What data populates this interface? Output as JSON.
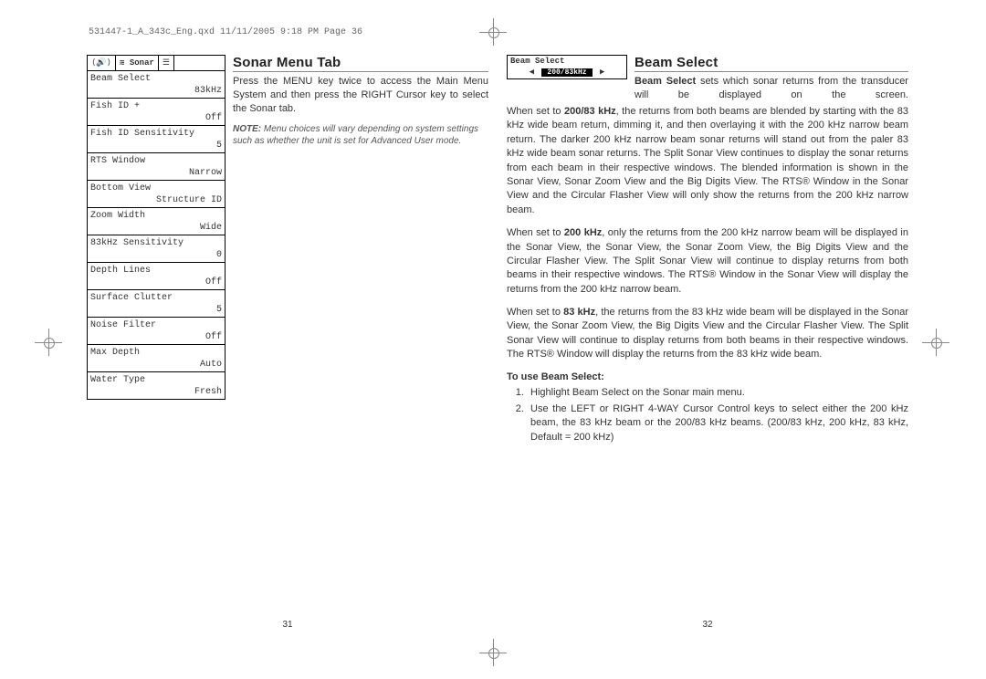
{
  "header_slug": "531447-1_A_343c_Eng.qxd  11/11/2005  9:18 PM  Page 36",
  "left": {
    "menu_caption": "Sonar Menu",
    "tabs": {
      "t1": "⟨🔊⟩",
      "t2": "≋ Sonar",
      "t3": "☰"
    },
    "rows": {
      "r0l": "Beam Select",
      "r0v": "83kHz",
      "r1l": "Fish ID +",
      "r1v": "Off",
      "r2l": "Fish ID Sensitivity",
      "r2v": "5",
      "r3l": "RTS Window",
      "r3v": "Narrow",
      "r4l": "Bottom View",
      "r4v": "Structure ID",
      "r5l": "Zoom Width",
      "r5v": "Wide",
      "r6l": "83kHz Sensitivity",
      "r6v": "0",
      "r7l": "Depth Lines",
      "r7v": "Off",
      "r8l": "Surface Clutter",
      "r8v": "5",
      "r9l": "Noise Filter",
      "r9v": "Off",
      "r10l": "Max Depth",
      "r10v": "Auto",
      "r11l": "Water Type",
      "r11v": "Fresh"
    },
    "heading": "Sonar Menu Tab",
    "body": "Press the MENU key twice to access the Main Menu System and then press the RIGHT Cursor key to select the Sonar tab.",
    "note_label": "NOTE:",
    "note": " Menu choices will vary depending on system settings such as whether the unit is set for Advanced User mode.",
    "page_num": "31"
  },
  "right": {
    "beam_title": "Beam Select",
    "beam_value": "200/83kHz",
    "heading": "Beam Select",
    "intro_b": "Beam Select",
    "intro": " sets which sonar returns from the transducer will be displayed on the screen.",
    "p1a": "When set to ",
    "p1b": "200/83 kHz",
    "p1c": ", the returns from both beams are blended by starting with the 83 kHz wide beam return, dimming it, and then overlaying it with the 200 kHz narrow beam return.  The darker 200 kHz narrow beam sonar returns will stand out from the paler 83 kHz wide beam sonar returns. The Split Sonar View continues to display the sonar returns from each beam in their respective windows.  The blended information is shown in the Sonar View, Sonar Zoom View and the Big Digits View. The RTS® Window in the Sonar View and the Circular Flasher View will only show the returns from the 200 kHz narrow beam.",
    "p2a": "When set to ",
    "p2b": "200 kHz",
    "p2c": ", only the returns from the 200 kHz narrow beam will be displayed in the Sonar View, the Sonar View, the Sonar Zoom View, the Big Digits View and the Circular Flasher View.  The Split Sonar View will continue to display returns from both beams in their respective windows.  The RTS® Window in the Sonar View will display the returns from the 200 kHz narrow beam.",
    "p3a": "When set to ",
    "p3b": "83 kHz",
    "p3c": ", the returns from the 83 kHz wide beam will be displayed in the Sonar View, the Sonar Zoom View, the Big Digits View and the Circular Flasher View.  The Split Sonar View will continue to display returns from both beams in their respective windows.  The RTS® Window will display the returns from the 83 kHz wide beam.",
    "use_head": "To use Beam Select:",
    "step1": "Highlight Beam Select on the Sonar main menu.",
    "step2": "Use the LEFT or RIGHT 4-WAY Cursor Control keys to select either the 200 kHz beam, the 83 kHz beam or the 200/83 kHz beams. (200/83 kHz, 200 kHz, 83 kHz, Default = 200 kHz)",
    "page_num": "32"
  }
}
